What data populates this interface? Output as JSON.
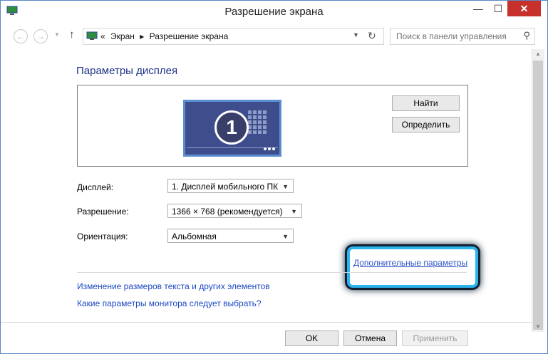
{
  "window": {
    "title": "Разрешение экрана"
  },
  "titlebar": {
    "minimize": "—",
    "maximize": "☐",
    "close": "✕"
  },
  "navigation": {
    "back": "←",
    "forward": "→",
    "up": "↑",
    "address": {
      "chevron": "«",
      "crumbs": [
        "Экран",
        "Разрешение экрана"
      ],
      "separator": "▸"
    },
    "refresh": "↻",
    "search_placeholder": "Поиск в панели управления"
  },
  "content": {
    "heading": "Параметры дисплея",
    "monitor_number": "1",
    "find_button": "Найти",
    "identify_button": "Определить",
    "display_label": "Дисплей:",
    "display_value": "1. Дисплей мобильного ПК",
    "resolution_label": "Разрешение:",
    "resolution_value": "1366 × 768 (рекомендуется)",
    "orientation_label": "Ориентация:",
    "orientation_value": "Альбомная",
    "advanced_link": "Дополнительные параметры",
    "link_text_size": "Изменение размеров текста и других элементов",
    "link_which_settings": "Какие параметры монитора следует выбрать?"
  },
  "footer": {
    "ok": "OK",
    "cancel": "Отмена",
    "apply": "Применить"
  },
  "colors": {
    "accent_heading": "#1e3287",
    "link": "#1a47c2",
    "highlight": "#2bb5ee",
    "close": "#c7312b"
  }
}
